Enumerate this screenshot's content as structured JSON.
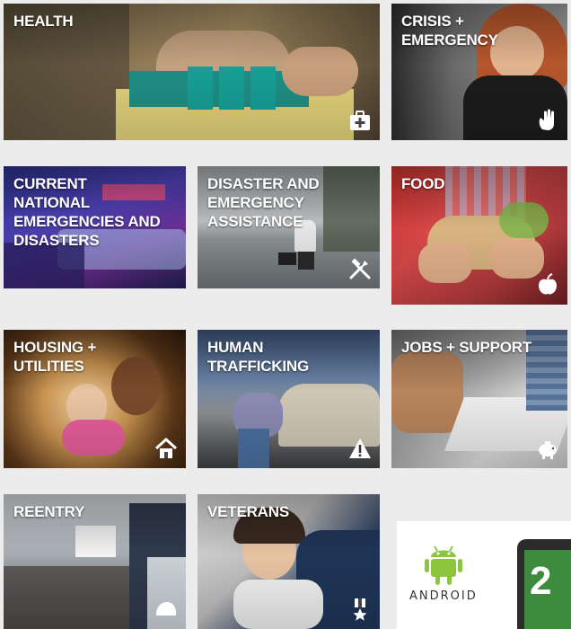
{
  "tiles": {
    "health": {
      "label": "HEALTH",
      "icon": "first-aid-kit-icon"
    },
    "crisis": {
      "label": "CRISIS +\nEMERGENCY",
      "icon": "hand-icon"
    },
    "national": {
      "label": "CURRENT\nNATIONAL\nEMERGENCIES AND\nDISASTERS"
    },
    "disaster": {
      "label": "DISASTER AND\nEMERGENCY\nASSISTANCE",
      "icon": "tools-icon"
    },
    "food": {
      "label": "FOOD",
      "icon": "apple-icon"
    },
    "housing": {
      "label": "HOUSING +\nUTILITIES",
      "icon": "house-icon"
    },
    "trafficking": {
      "label": "HUMAN\nTRAFFICKING",
      "icon": "warning-icon"
    },
    "jobs": {
      "label": "JOBS + SUPPORT",
      "icon": "piggy-bank-icon"
    },
    "reentry": {
      "label": "REENTRY",
      "icon": "helmet-icon"
    },
    "veterans": {
      "label": "VETERANS",
      "icon": "medal-icon"
    }
  },
  "promo": {
    "android_label": "ANDROID",
    "logo_icon": "android-robot-icon",
    "device_digit": "2"
  },
  "colors": {
    "background": "#ececec",
    "android_green": "#8cc63f",
    "device_screen_green": "#3d8c3d"
  }
}
